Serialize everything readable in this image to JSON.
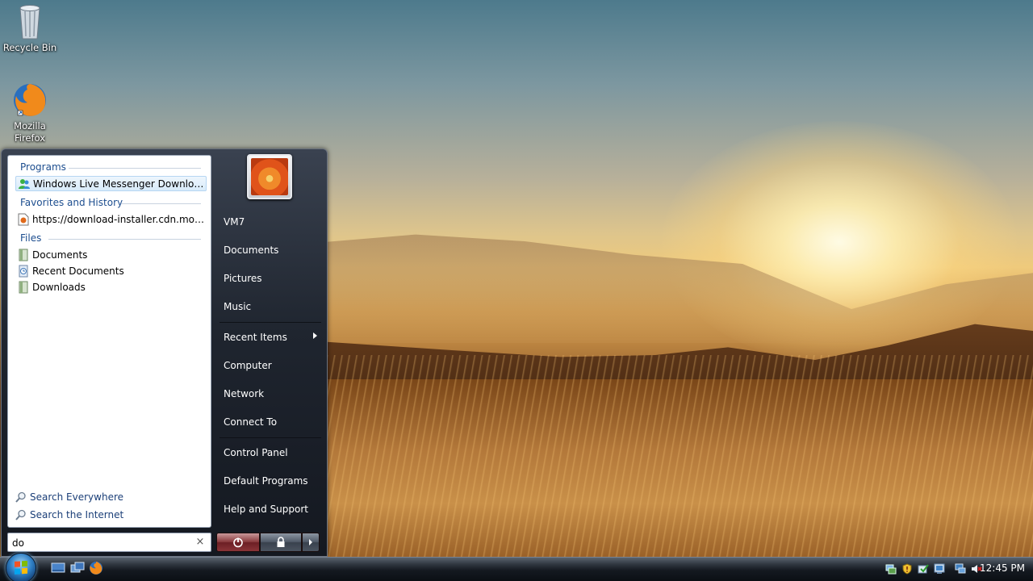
{
  "desktop": {
    "icons": [
      {
        "label": "Recycle Bin",
        "icon": "recycle-bin-icon"
      },
      {
        "label": "Mozilla Firefox",
        "icon": "firefox-icon"
      }
    ]
  },
  "start_menu": {
    "sections": {
      "programs": "Programs",
      "favorites": "Favorites and History",
      "files": "Files"
    },
    "programs": [
      {
        "label": "Windows Live Messenger Download",
        "icon": "messenger-icon",
        "selected": true
      }
    ],
    "favorites": [
      {
        "label": "https://download-installer.cdn.mozilla....",
        "icon": "web-page-icon"
      }
    ],
    "files": [
      {
        "label": "Documents",
        "icon": "library-icon"
      },
      {
        "label": "Recent Documents",
        "icon": "recent-documents-icon"
      },
      {
        "label": "Downloads",
        "icon": "library-icon"
      }
    ],
    "search_links": [
      {
        "label": "Search Everywhere",
        "icon": "search-icon"
      },
      {
        "label": "Search the Internet",
        "icon": "search-icon"
      }
    ],
    "search_box": {
      "value": "do",
      "clear_glyph": "×"
    },
    "right_items": {
      "user": "VM7",
      "documents": "Documents",
      "pictures": "Pictures",
      "music": "Music",
      "recent_items": "Recent Items",
      "computer": "Computer",
      "network": "Network",
      "connect_to": "Connect To",
      "control_panel": "Control Panel",
      "default_programs": "Default Programs",
      "help_and_support": "Help and Support"
    }
  },
  "taskbar": {
    "quick_launch": [
      "show-desktop-icon",
      "switch-windows-icon",
      "firefox-icon"
    ],
    "tray_icons": [
      "network-status-icon",
      "security-shield-icon",
      "windows-update-icon",
      "action-center-icon",
      "display-icon",
      "volume-muted-icon"
    ],
    "clock": "12:45 PM"
  },
  "colors": {
    "accent": "#1d4e8f",
    "menu_dark": "#1f252f",
    "power_button": "#8a3a3d"
  }
}
